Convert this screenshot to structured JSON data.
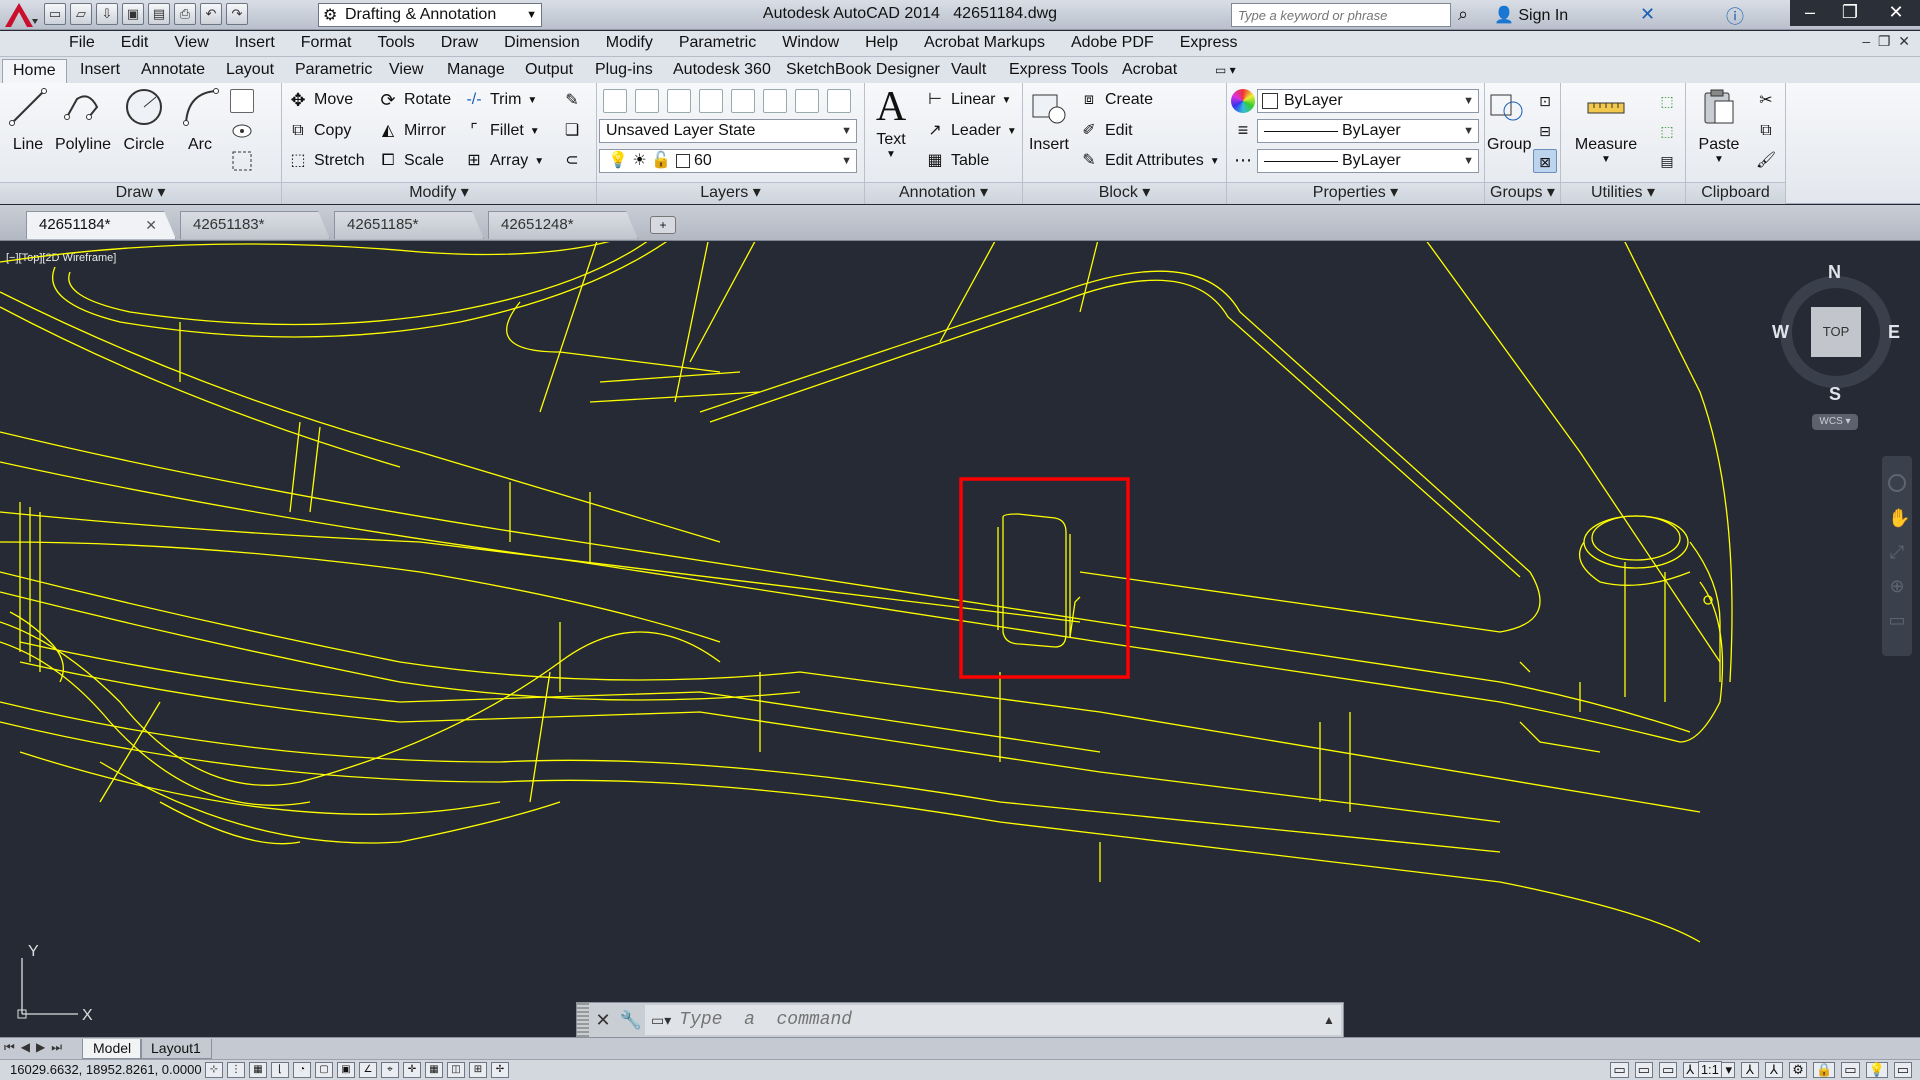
{
  "title_bar": {
    "workspace": "Drafting & Annotation",
    "app_title": "Autodesk AutoCAD 2014",
    "file_name": "42651184.dwg",
    "search_placeholder": "Type a keyword or phrase",
    "sign_in": "Sign In"
  },
  "menu": [
    "File",
    "Edit",
    "View",
    "Insert",
    "Format",
    "Tools",
    "Draw",
    "Dimension",
    "Modify",
    "Parametric",
    "Window",
    "Help",
    "Acrobat Markups",
    "Adobe PDF",
    "Express"
  ],
  "ribbon_tabs": [
    "Home",
    "Insert",
    "Annotate",
    "Layout",
    "Parametric",
    "View",
    "Manage",
    "Output",
    "Plug-ins",
    "Autodesk 360",
    "SketchBook Designer",
    "Vault",
    "Express Tools",
    "Acrobat"
  ],
  "ribbon": {
    "draw": {
      "title": "Draw",
      "line": "Line",
      "polyline": "Polyline",
      "circle": "Circle",
      "arc": "Arc"
    },
    "modify": {
      "title": "Modify",
      "move": "Move",
      "rotate": "Rotate",
      "trim": "Trim",
      "copy": "Copy",
      "mirror": "Mirror",
      "fillet": "Fillet",
      "stretch": "Stretch",
      "scale": "Scale",
      "array": "Array"
    },
    "layers": {
      "title": "Layers",
      "layer_state": "Unsaved Layer State",
      "current_layer": "60"
    },
    "annotation": {
      "title": "Annotation",
      "text": "Text",
      "linear": "Linear",
      "leader": "Leader",
      "table": "Table"
    },
    "block": {
      "title": "Block",
      "insert": "Insert",
      "create": "Create",
      "edit": "Edit",
      "edit_attributes": "Edit Attributes"
    },
    "properties": {
      "title": "Properties",
      "color": "ByLayer",
      "linetype": "ByLayer",
      "lineweight": "ByLayer"
    },
    "groups": {
      "title": "Groups",
      "group": "Group"
    },
    "utilities": {
      "title": "Utilities",
      "measure": "Measure"
    },
    "clipboard": {
      "title": "Clipboard",
      "paste": "Paste"
    }
  },
  "doc_tabs": [
    "42651184*",
    "42651183*",
    "42651185*",
    "42651248*"
  ],
  "viewport_label": "[−][Top][2D Wireframe]",
  "viewcube": {
    "n": "N",
    "s": "S",
    "e": "E",
    "w": "W",
    "face": "TOP",
    "wcs": "WCS"
  },
  "ucs": {
    "x": "X",
    "y": "Y"
  },
  "command": {
    "placeholder": "Type  a  command"
  },
  "layout_tabs": [
    "Model",
    "Layout1"
  ],
  "status": {
    "coords": "16029.6632, 18952.8261, 0.0000",
    "scale": "1:1"
  },
  "colors": {
    "background": "#252a34",
    "wireframe": "#ffff00",
    "highlight": "#ff0000"
  }
}
